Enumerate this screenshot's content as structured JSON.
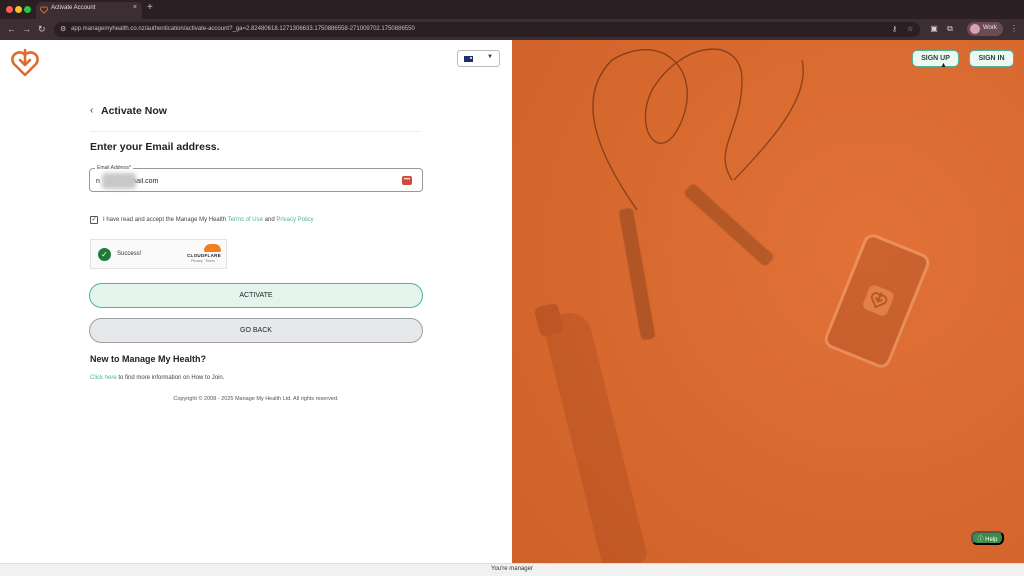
{
  "browser": {
    "tab_title": "Activate Account",
    "tab_close": "×",
    "new_tab": "+",
    "url": "app.managemyhealth.co.nz/authentication/activate-account?_ga=2.82480618.1271306633.1750886558-271009702.1750886550",
    "profile_label": "Work",
    "nav_back": "←",
    "nav_forward": "→",
    "nav_reload": "↻",
    "menu": "⋮"
  },
  "header": {
    "sign_up": "SIGN UP",
    "sign_in": "SIGN IN"
  },
  "form": {
    "back_title": "Activate Now",
    "heading": "Enter your Email address.",
    "email_label": "Email Address*",
    "email_value": "n        1@gmail.com",
    "terms_prefix": "I have read and accept the Manage My Health ",
    "terms_link": "Terms of Use",
    "terms_and": " and ",
    "privacy_link": "Privacy Policy",
    "captcha_status": "Success!",
    "captcha_brand": "CLOUDFLARE",
    "captcha_sub": "Privacy · Terms",
    "activate": "ACTIVATE",
    "go_back": "GO BACK",
    "new_title": "New to Manage My Health?",
    "click_here": "Click here",
    "info_suffix": " to find more information on How to Join.",
    "copyright": "Copyright © 2008 - 2025 Manage My Health Ltd. All rights reserved."
  },
  "help_label": "Help",
  "status_bar": "You're manager",
  "colors": {
    "brand_orange": "#e06a2c",
    "accent_green": "#4fb39a",
    "help_green": "#3a8d4a"
  }
}
